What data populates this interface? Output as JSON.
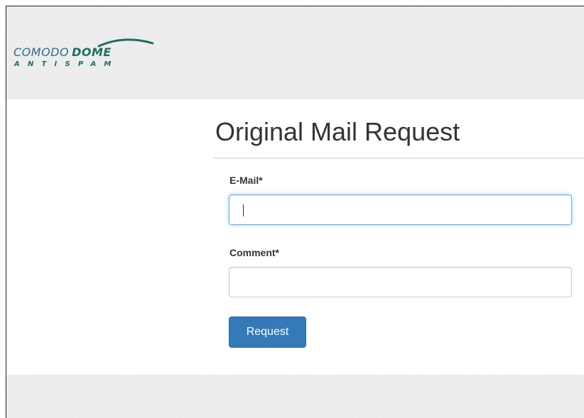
{
  "brand": {
    "name_part1": "COMODO",
    "name_part2": "DOME",
    "tagline": "ANTISPAM",
    "color_primary": "#2f6b8f",
    "color_accent": "#1c6f62"
  },
  "page": {
    "title": "Original Mail Request"
  },
  "form": {
    "email_label": "E-Mail*",
    "email_value": "",
    "comment_label": "Comment*",
    "comment_value": "",
    "submit_label": "Request",
    "submit_color": "#337ab7",
    "focus_color": "#66afe9"
  }
}
